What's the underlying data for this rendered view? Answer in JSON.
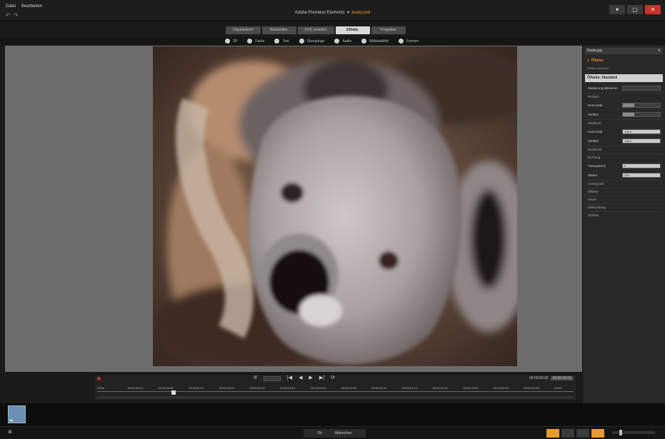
{
  "window": {
    "menu": [
      "Datei",
      "Bearbeiten"
    ],
    "history": [
      "↶",
      "↷"
    ],
    "title": "Adobe Premiere Elements",
    "project": "koala.prel"
  },
  "tabs": [
    "Organisieren",
    "Bearbeiten",
    "DVD erstellen",
    "Effekte",
    "Freigeben"
  ],
  "active_tab": "Effekte",
  "categories": [
    "3D",
    "Farbe",
    "Text",
    "Übergänge",
    "Audio",
    "Bildstabilität",
    "Formen"
  ],
  "transport": {
    "buttons": [
      "↺",
      "|◀",
      "◀",
      "▶",
      "▶|",
      "⟳"
    ],
    "timecode": "00:00:00:02",
    "timecode_right": "00:00:00:03",
    "ruler": [
      "00:00",
      "00:00:00:04",
      "00:00:00:08",
      "00:00:00:12",
      "00:00:00:16",
      "00:00:00:20",
      "00:00:01:00",
      "00:00:01:04",
      "00:00:01:08",
      "00:00:01:12",
      "00:00:01:16",
      "00:00:01:20",
      "00:00:02:00",
      "00:00:02:04",
      "00:00:02:08",
      "02:00"
    ]
  },
  "panel": {
    "title": "Koala.jpg",
    "clip_name": "Ölfarbe",
    "sub": "Effekte aktivieren",
    "preset": "Ölfarbe: Standard",
    "scaling_label": "Skalierung aktivieren",
    "sections": {
      "bewegung": "Position",
      "skalierung": "Skalieren",
      "deckkraft": "Deckkraft",
      "drehung": "Drehung",
      "ankerpunkt": "Ankerpunkt",
      "olfarbe": "Ölfarbe",
      "pinsel": "Pinsel",
      "beleuchtung": "Beleuchtung",
      "struktur": "Struktur"
    },
    "rows": [
      {
        "k": "Horizontal",
        "v": "0.0",
        "fill": 0.3
      },
      {
        "k": "Vertikal",
        "v": "0.0",
        "fill": 0.3
      },
      {
        "k": "Horizontal",
        "v": "100.0",
        "fill": 0.6
      },
      {
        "k": "Vertikal",
        "v": "100.0",
        "fill": 0.6
      },
      {
        "k": "Transparenz",
        "v": "0",
        "fill": 0.0
      },
      {
        "k": "Stärke",
        "v": "100",
        "fill": 0.4
      }
    ]
  },
  "status": {
    "left": "⌘",
    "mid": [
      "Ok",
      "Abbrechen"
    ]
  }
}
